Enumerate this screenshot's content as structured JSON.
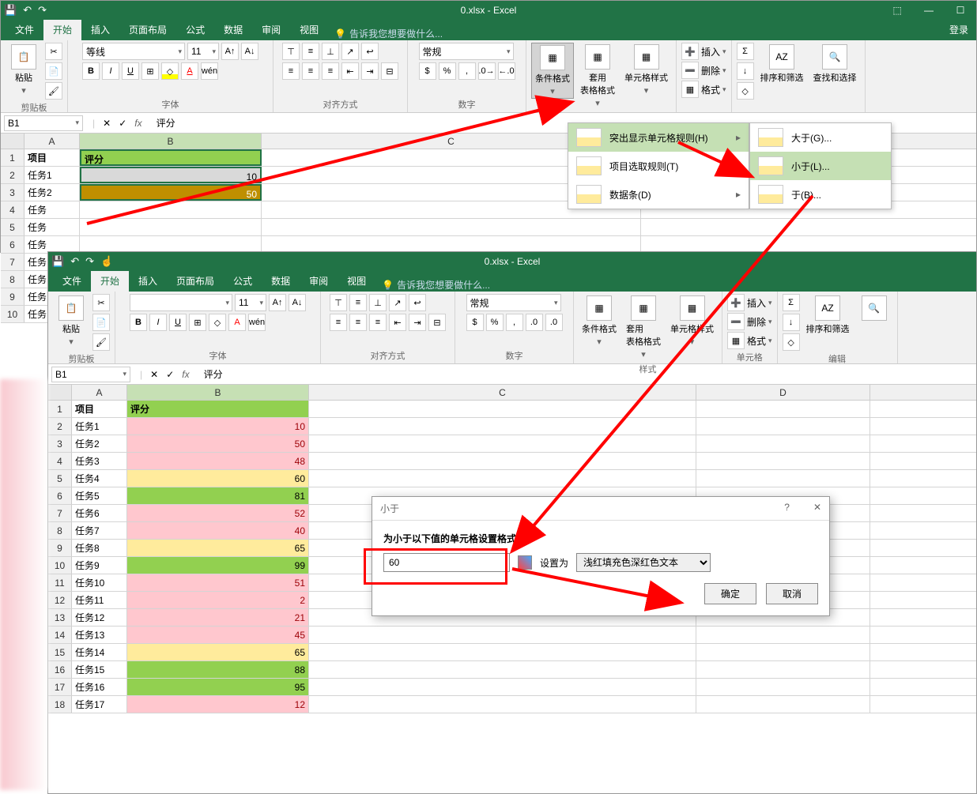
{
  "app": {
    "title": "0.xlsx - Excel",
    "login": "登录"
  },
  "tabs": [
    "文件",
    "开始",
    "插入",
    "页面布局",
    "公式",
    "数据",
    "审阅",
    "视图"
  ],
  "tellme": "告诉我您想要做什么...",
  "ribbon": {
    "clipboard": "剪贴板",
    "paste": "粘贴",
    "font": "字体",
    "fontname": "等线",
    "fontsize": "11",
    "align": "对齐方式",
    "number": "数字",
    "numfmt": "常规",
    "styles": "样式",
    "condfmt": "条件格式",
    "tablefmt": "套用\n表格格式",
    "cellstyle": "单元格样式",
    "cells": "单元格",
    "insert": "插入",
    "delete": "删除",
    "format": "格式",
    "editing": "编辑",
    "sortfilter": "排序和筛选",
    "findsel": "查找和选择"
  },
  "namebox": "B1",
  "formula": "评分",
  "menu1": {
    "highlight": "突出显示单元格规则(H)",
    "topbottom": "项目选取规则(T)",
    "databar": "数据条(D)"
  },
  "menu2": {
    "gt": "大于(G)...",
    "lt": "小于(L)...",
    "bt": "于(B)..."
  },
  "dialog": {
    "title": "小于",
    "label": "为小于以下值的单元格设置格式:",
    "value": "60",
    "setas": "设置为",
    "preset": "浅红填充色深红色文本",
    "ok": "确定",
    "cancel": "取消"
  },
  "cols_top": {
    "A": 70,
    "B": 230,
    "C": 480
  },
  "rows_top": [
    {
      "n": 1,
      "a": "项目",
      "b": "评分",
      "hdr": true
    },
    {
      "n": 2,
      "a": "任务1",
      "b": "10"
    },
    {
      "n": 3,
      "a": "任务2",
      "b": "50"
    }
  ],
  "rows_top_rest": [
    "任务",
    "任务",
    "任务",
    "任务",
    "任务",
    "任务",
    "任务"
  ],
  "cols_bot": {
    "A": 70,
    "B": 230,
    "C": 490,
    "D": 220
  },
  "rows_bot": [
    {
      "n": 1,
      "a": "项目",
      "b": "评分",
      "cls": "hl-header"
    },
    {
      "n": 2,
      "a": "任务1",
      "b": "10",
      "cls": "hl-pink"
    },
    {
      "n": 3,
      "a": "任务2",
      "b": "50",
      "cls": "hl-pink"
    },
    {
      "n": 4,
      "a": "任务3",
      "b": "48",
      "cls": "hl-pink"
    },
    {
      "n": 5,
      "a": "任务4",
      "b": "60",
      "cls": "hl-yellow"
    },
    {
      "n": 6,
      "a": "任务5",
      "b": "81",
      "cls": "hl-green"
    },
    {
      "n": 7,
      "a": "任务6",
      "b": "52",
      "cls": "hl-pink"
    },
    {
      "n": 8,
      "a": "任务7",
      "b": "40",
      "cls": "hl-pink"
    },
    {
      "n": 9,
      "a": "任务8",
      "b": "65",
      "cls": "hl-yellow"
    },
    {
      "n": 10,
      "a": "任务9",
      "b": "99",
      "cls": "hl-green"
    },
    {
      "n": 11,
      "a": "任务10",
      "b": "51",
      "cls": "hl-pink"
    },
    {
      "n": 12,
      "a": "任务11",
      "b": "2",
      "cls": "hl-pink"
    },
    {
      "n": 13,
      "a": "任务12",
      "b": "21",
      "cls": "hl-pink"
    },
    {
      "n": 14,
      "a": "任务13",
      "b": "45",
      "cls": "hl-pink"
    },
    {
      "n": 15,
      "a": "任务14",
      "b": "65",
      "cls": "hl-yellow"
    },
    {
      "n": 16,
      "a": "任务15",
      "b": "88",
      "cls": "hl-green"
    },
    {
      "n": 17,
      "a": "任务16",
      "b": "95",
      "cls": "hl-green"
    },
    {
      "n": 18,
      "a": "任务17",
      "b": "12",
      "cls": "hl-pink"
    }
  ]
}
